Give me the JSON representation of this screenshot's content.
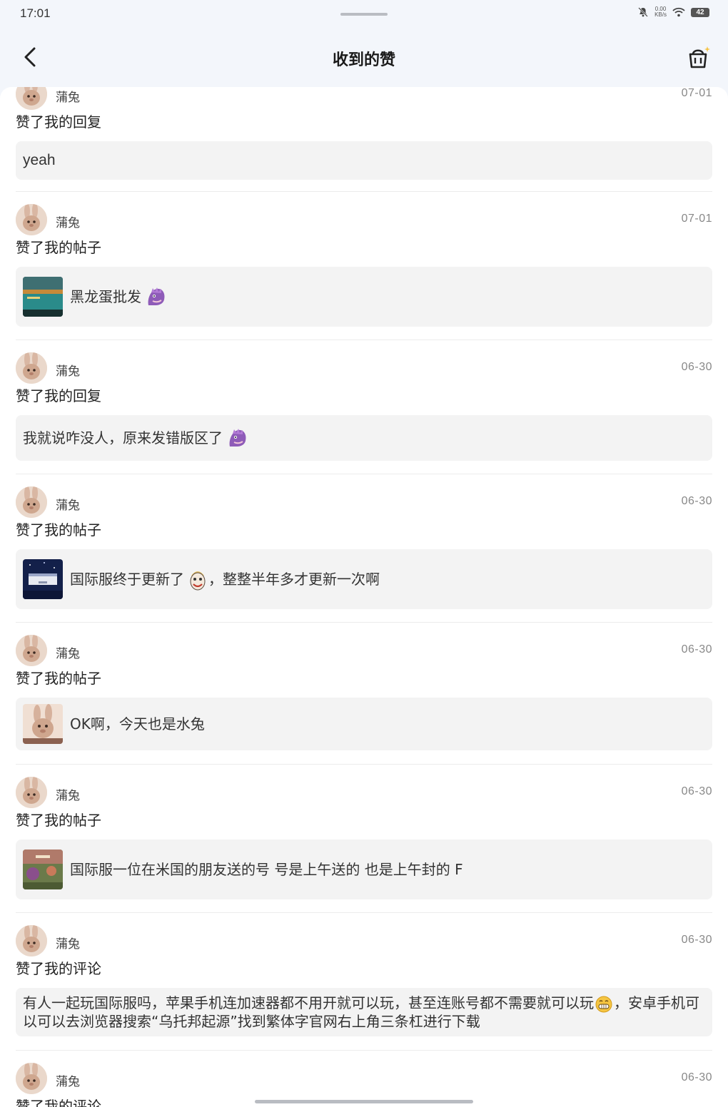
{
  "status_bar": {
    "time": "17:01",
    "net_speed_value": "0.00",
    "net_speed_unit": "KB/s",
    "battery": "42"
  },
  "header": {
    "title": "收到的赞"
  },
  "items": [
    {
      "user": "蒲兔",
      "date": "07-01",
      "action": "赞了我的回复",
      "content": "yeah",
      "has_thumb": false
    },
    {
      "user": "蒲兔",
      "date": "07-01",
      "action": "赞了我的帖子",
      "content": "黑龙蛋批发",
      "has_thumb": true
    },
    {
      "user": "蒲兔",
      "date": "06-30",
      "action": "赞了我的回复",
      "content": "我就说咋没人，原来发错版区了",
      "has_thumb": false
    },
    {
      "user": "蒲兔",
      "date": "06-30",
      "action": "赞了我的帖子",
      "content_a": "国际服终于更新了",
      "content_b": "，整整半年多才更新一次啊",
      "has_thumb": true
    },
    {
      "user": "蒲兔",
      "date": "06-30",
      "action": "赞了我的帖子",
      "content": "OK啊，今天也是水兔",
      "has_thumb": true
    },
    {
      "user": "蒲兔",
      "date": "06-30",
      "action": "赞了我的帖子",
      "content": "国际服一位在米国的朋友送的号 号是上午送的 也是上午封的 F",
      "has_thumb": true
    },
    {
      "user": "蒲兔",
      "date": "06-30",
      "action": "赞了我的评论",
      "content_a": "有人一起玩国际服吗，苹果手机连加速器都不用开就可以玩，甚至连账号都不需要就可以玩",
      "content_b": "，安卓手机可以可以去浏览器搜索“乌托邦起源”找到繁体字官网右上角三条杠进行下载",
      "has_thumb": false
    },
    {
      "user": "蒲兔",
      "date": "06-30",
      "action": "赞了我的评论"
    }
  ]
}
